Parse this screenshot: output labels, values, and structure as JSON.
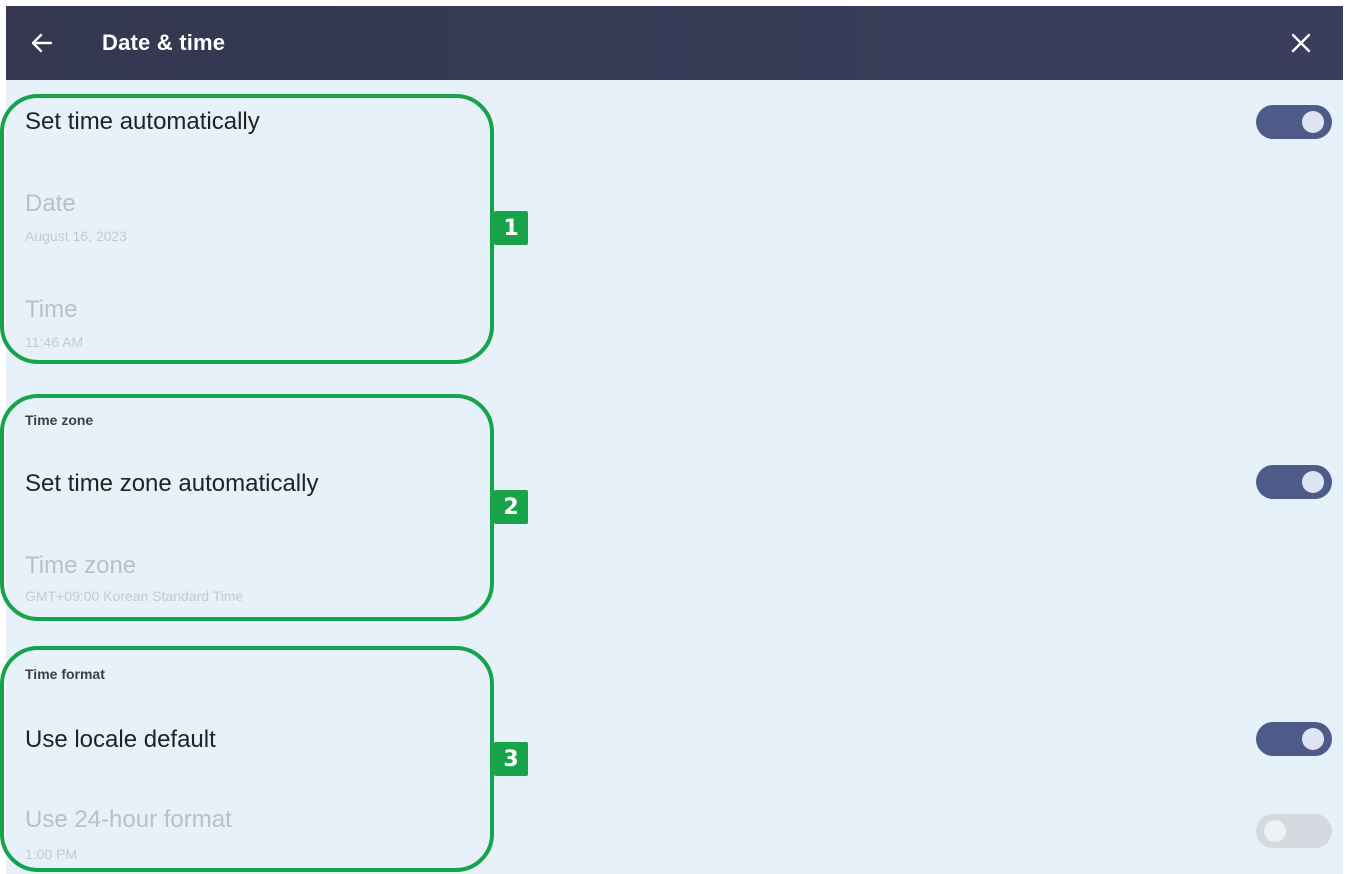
{
  "header": {
    "title": "Date & time",
    "back_icon": "arrow-left-icon",
    "close_icon": "close-icon"
  },
  "auto_time": {
    "label": "Set time automatically",
    "toggle_state": "on"
  },
  "date": {
    "label": "Date",
    "value": "August 16, 2023"
  },
  "time": {
    "label": "Time",
    "value": "11:46 AM"
  },
  "time_zone_section": {
    "header": "Time zone",
    "auto_label": "Set time zone automatically",
    "toggle_state": "on",
    "zone_label": "Time zone",
    "zone_value": "GMT+09:00 Korean Standard Time"
  },
  "time_format_section": {
    "header": "Time format",
    "locale_label": "Use locale default",
    "locale_toggle_state": "on",
    "h24_label": "Use 24-hour format",
    "h24_value": "1:00 PM",
    "h24_toggle_state": "off"
  },
  "badges": [
    "1",
    "2",
    "3"
  ],
  "colors": {
    "topbar": "#373a55",
    "background": "#e6f1f9",
    "toggle_on": "#4e5a88",
    "toggle_off": "#d3d9df",
    "highlight": "#16a34a"
  }
}
